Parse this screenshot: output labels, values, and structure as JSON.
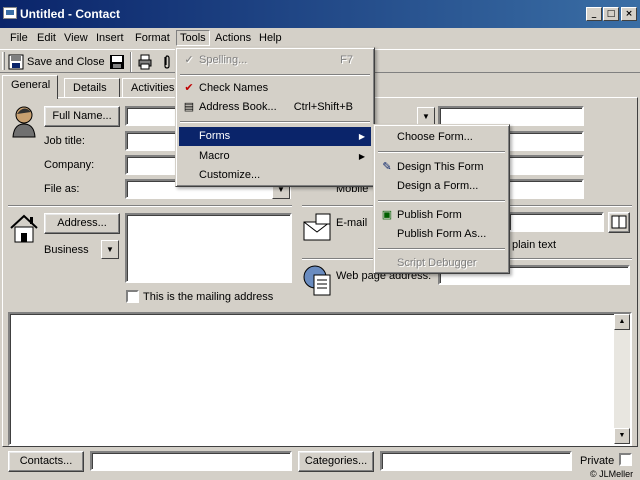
{
  "window": {
    "title": "Untitled - Contact",
    "controls": [
      "_",
      "□",
      "×"
    ]
  },
  "menubar": [
    "File",
    "Edit",
    "View",
    "Insert",
    "Format",
    "Tools",
    "Actions",
    "Help"
  ],
  "toolbar": {
    "save_close": "Save and Close"
  },
  "tabs": [
    "General",
    "Details",
    "Activities"
  ],
  "form": {
    "full_name": "Full Name...",
    "job_title": "Job title:",
    "company": "Company:",
    "file_as": "File as:",
    "address": "Address...",
    "business": "Business",
    "mailing": "This is the mailing address",
    "mobile": "Mobile",
    "email": "E-mail",
    "plain_text": "plain text",
    "web_page": "Web page address:",
    "contacts": "Contacts...",
    "categories": "Categories...",
    "private": "Private",
    "copyright": "© JLMeller"
  },
  "tools_menu": {
    "items": [
      {
        "label": "Spelling...",
        "shortcut": "F7",
        "icon": "spelling-icon"
      },
      {
        "label": "Check Names",
        "icon": "check-names-icon"
      },
      {
        "label": "Address Book...",
        "shortcut": "Ctrl+Shift+B",
        "icon": "address-book-icon"
      },
      {
        "label": "Forms"
      },
      {
        "label": "Macro"
      },
      {
        "label": "Customize..."
      }
    ]
  },
  "forms_menu": {
    "items": [
      {
        "label": "Choose Form..."
      },
      {
        "label": "Design This Form",
        "icon": "design-form-icon"
      },
      {
        "label": "Design a Form..."
      },
      {
        "label": "Publish Form",
        "icon": "publish-form-icon"
      },
      {
        "label": "Publish Form As..."
      },
      {
        "label": "Script Debugger"
      }
    ]
  },
  "colors": {
    "highlight": "#0a246a",
    "face": "#d4d0c8",
    "title_start": "#0a246a",
    "title_end": "#3a6ea5"
  }
}
